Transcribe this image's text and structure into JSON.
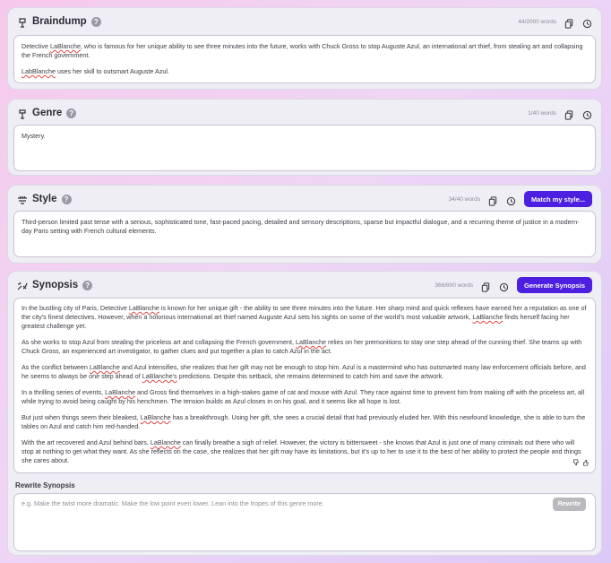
{
  "braindump": {
    "title": "Braindump",
    "words": "44/2000 words",
    "para1_a": "Detective ",
    "para1_name": "LaBlanche",
    "para1_b": ", who is famous for her unique ability to see three minutes into the future, works with Chuck Gross to stop Auguste Azul, an international art thief, from stealing art and collapsing the French government.",
    "para2_name": "LabBlanche",
    "para2_b": " uses her skill to outsmart Auguste Azul."
  },
  "genre": {
    "title": "Genre",
    "words": "1/40 words",
    "value": "Mystery."
  },
  "style": {
    "title": "Style",
    "words": "34/40 words",
    "button": "Match my style...",
    "value": "Third-person limited past tense with a serious, sophisticated tone, fast-paced pacing, detailed and sensory descriptions, sparse but impactful dialogue, and a recurring theme of justice in a modern-day Paris setting with French cultural elements."
  },
  "synopsis": {
    "title": "Synopsis",
    "words": "366/800 words",
    "button": "Generate Synopsis",
    "p1_a": "In the bustling city of Paris, Detective ",
    "p1_n1": "LaBlanche",
    "p1_b": " is known for her unique gift - the ability to see three minutes into the future. Her sharp mind and quick reflexes have earned her a reputation as one of the city's finest detectives. However, when a notorious international art thief named Auguste Azul sets his sights on some of the world's most valuable artwork, ",
    "p1_n2": "LaBlanche",
    "p1_c": " finds herself facing her greatest challenge yet.",
    "p2_a": "As she works to stop Azul from stealing the priceless art and collapsing the French government, ",
    "p2_n1": "LaBlanche",
    "p2_b": " relies on her premonitions to stay one step ahead of the cunning thief. She teams up with Chuck Gross, an experienced art investigator, to gather clues and put together a plan to catch Azul in the act.",
    "p3_a": "As the conflict between ",
    "p3_n1": "LaBlanche",
    "p3_b": " and Azul intensifies, she realizes that her gift may not be enough to stop him. Azul is a mastermind who has outsmarted many law enforcement officials before, and he seems to always be one step ahead of ",
    "p3_n2": "LaBlanche's",
    "p3_c": " predictions. Despite this setback, she remains determined to catch him and save the artwork.",
    "p4_a": "In a thrilling series of events, ",
    "p4_n1": "LaBlanche",
    "p4_b": " and Gross find themselves in a high-stakes game of cat and mouse with Azul. They race against time to prevent him from making off with the priceless art, all while trying to avoid being caught by his henchmen. The tension builds as Azul closes in on his goal, and it seems like all hope is lost.",
    "p5_a": "But just when things seem their bleakest, ",
    "p5_n1": "LaBlanche",
    "p5_b": " has a breakthrough. Using her gift, she sees a crucial detail that had previously eluded her. With this newfound knowledge, she is able to turn the tables on Azul and catch him red-handed.",
    "p6_a": "With the art recovered and Azul behind bars, ",
    "p6_n1": "LaBlanche",
    "p6_b": " can finally breathe a sigh of relief. However, the victory is bittersweet - she knows that Azul is just one of many criminals out there who will stop at nothing to get what they want. As she reflects on the case, she realizes that her gift may have its limitations, but it's up to her to use it to the best of her ability to protect the people and things she cares about.",
    "rewrite_label": "Rewrite Synopsis",
    "rewrite_placeholder": "e.g. Make the twist more dramatic. Make the low point even lower. Lean into the tropes of this genre more.",
    "rewrite_button": "Rewrite"
  },
  "icons": {
    "braindump": "brain-icon",
    "genre": "genre-icon",
    "style": "style-icon",
    "synopsis": "synopsis-icon",
    "help": "help-icon",
    "copy": "copy-icon",
    "history": "history-icon",
    "thumbs_down": "thumbs-down-icon",
    "thumbs_up": "thumbs-up-icon"
  },
  "help_glyph": "?",
  "colors": {
    "accent": "#4d1fe0",
    "card": "#efeef4"
  }
}
